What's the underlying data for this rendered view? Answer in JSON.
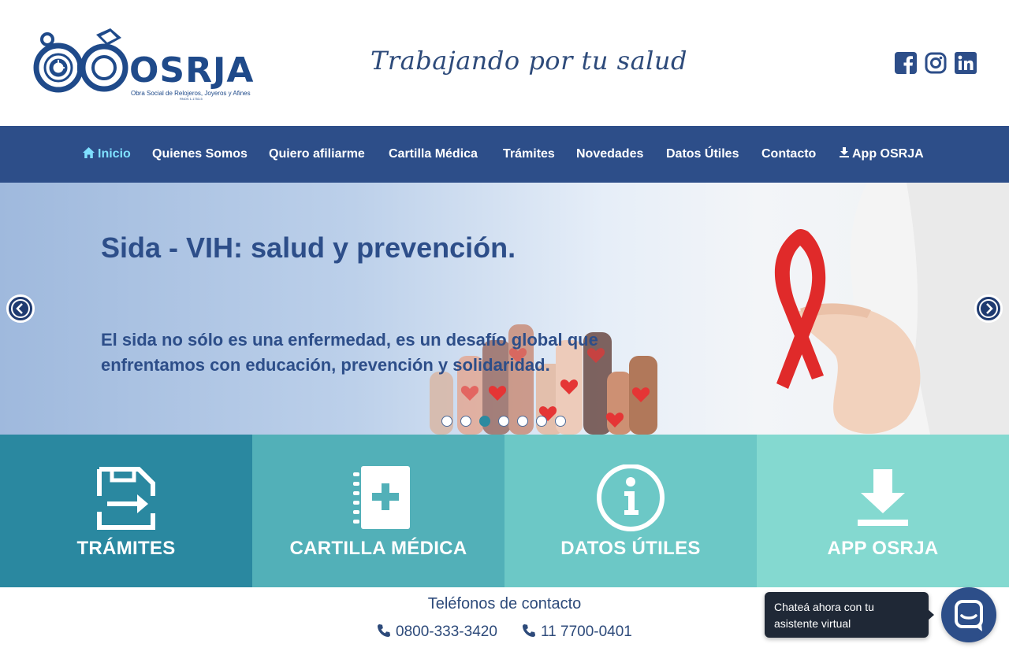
{
  "header": {
    "logo_text": "OSRJA",
    "logo_subtitle": "Obra Social de Relojeros, Joyeros y Afines",
    "logo_registry": "RNOS 1-1753-5",
    "tagline": "Trabajando por tu salud",
    "social": [
      {
        "name": "facebook-icon",
        "color": "#2d4e89"
      },
      {
        "name": "instagram-icon",
        "color": "#2d4e89"
      },
      {
        "name": "linkedin-icon",
        "color": "#2d4e89"
      }
    ]
  },
  "nav": {
    "items": [
      {
        "label": "Inicio",
        "icon": "home-icon",
        "active": true
      },
      {
        "label": "Quienes Somos"
      },
      {
        "label": "Quiero afiliarme"
      },
      {
        "label": "Cartilla Médica"
      },
      {
        "label": "Trámites"
      },
      {
        "label": "Novedades"
      },
      {
        "label": "Datos Útiles"
      },
      {
        "label": "Contacto"
      },
      {
        "label": "App OSRJA",
        "icon": "download-icon"
      }
    ]
  },
  "hero": {
    "title": "Sida - VIH: salud y prevención.",
    "text": "El sida no sólo es una enfermedad, es un desafío global que enfrentamos con educación, prevención y solidaridad.",
    "slide_count": 7,
    "active_slide": 3
  },
  "tiles": [
    {
      "label": "TRÁMITES",
      "icon": "form-transfer-icon",
      "color": "#2a88a0"
    },
    {
      "label": "CARTILLA MÉDICA",
      "icon": "medical-book-icon",
      "color": "#52b0b8"
    },
    {
      "label": "DATOS ÚTILES",
      "icon": "info-icon",
      "color": "#6cc8c6"
    },
    {
      "label": "APP OSRJA",
      "icon": "download-icon",
      "color": "#84d9d0"
    }
  ],
  "contact": {
    "title": "Teléfonos de contacto",
    "phones": [
      "0800-333-3420",
      "11 7700-0401"
    ]
  },
  "chat": {
    "bubble_text": "Chateá ahora con tu asistente virtual"
  },
  "colors": {
    "nav": "#2d4e89",
    "active_nav": "#7fe0ff",
    "primary_text": "#2d4a7a"
  }
}
